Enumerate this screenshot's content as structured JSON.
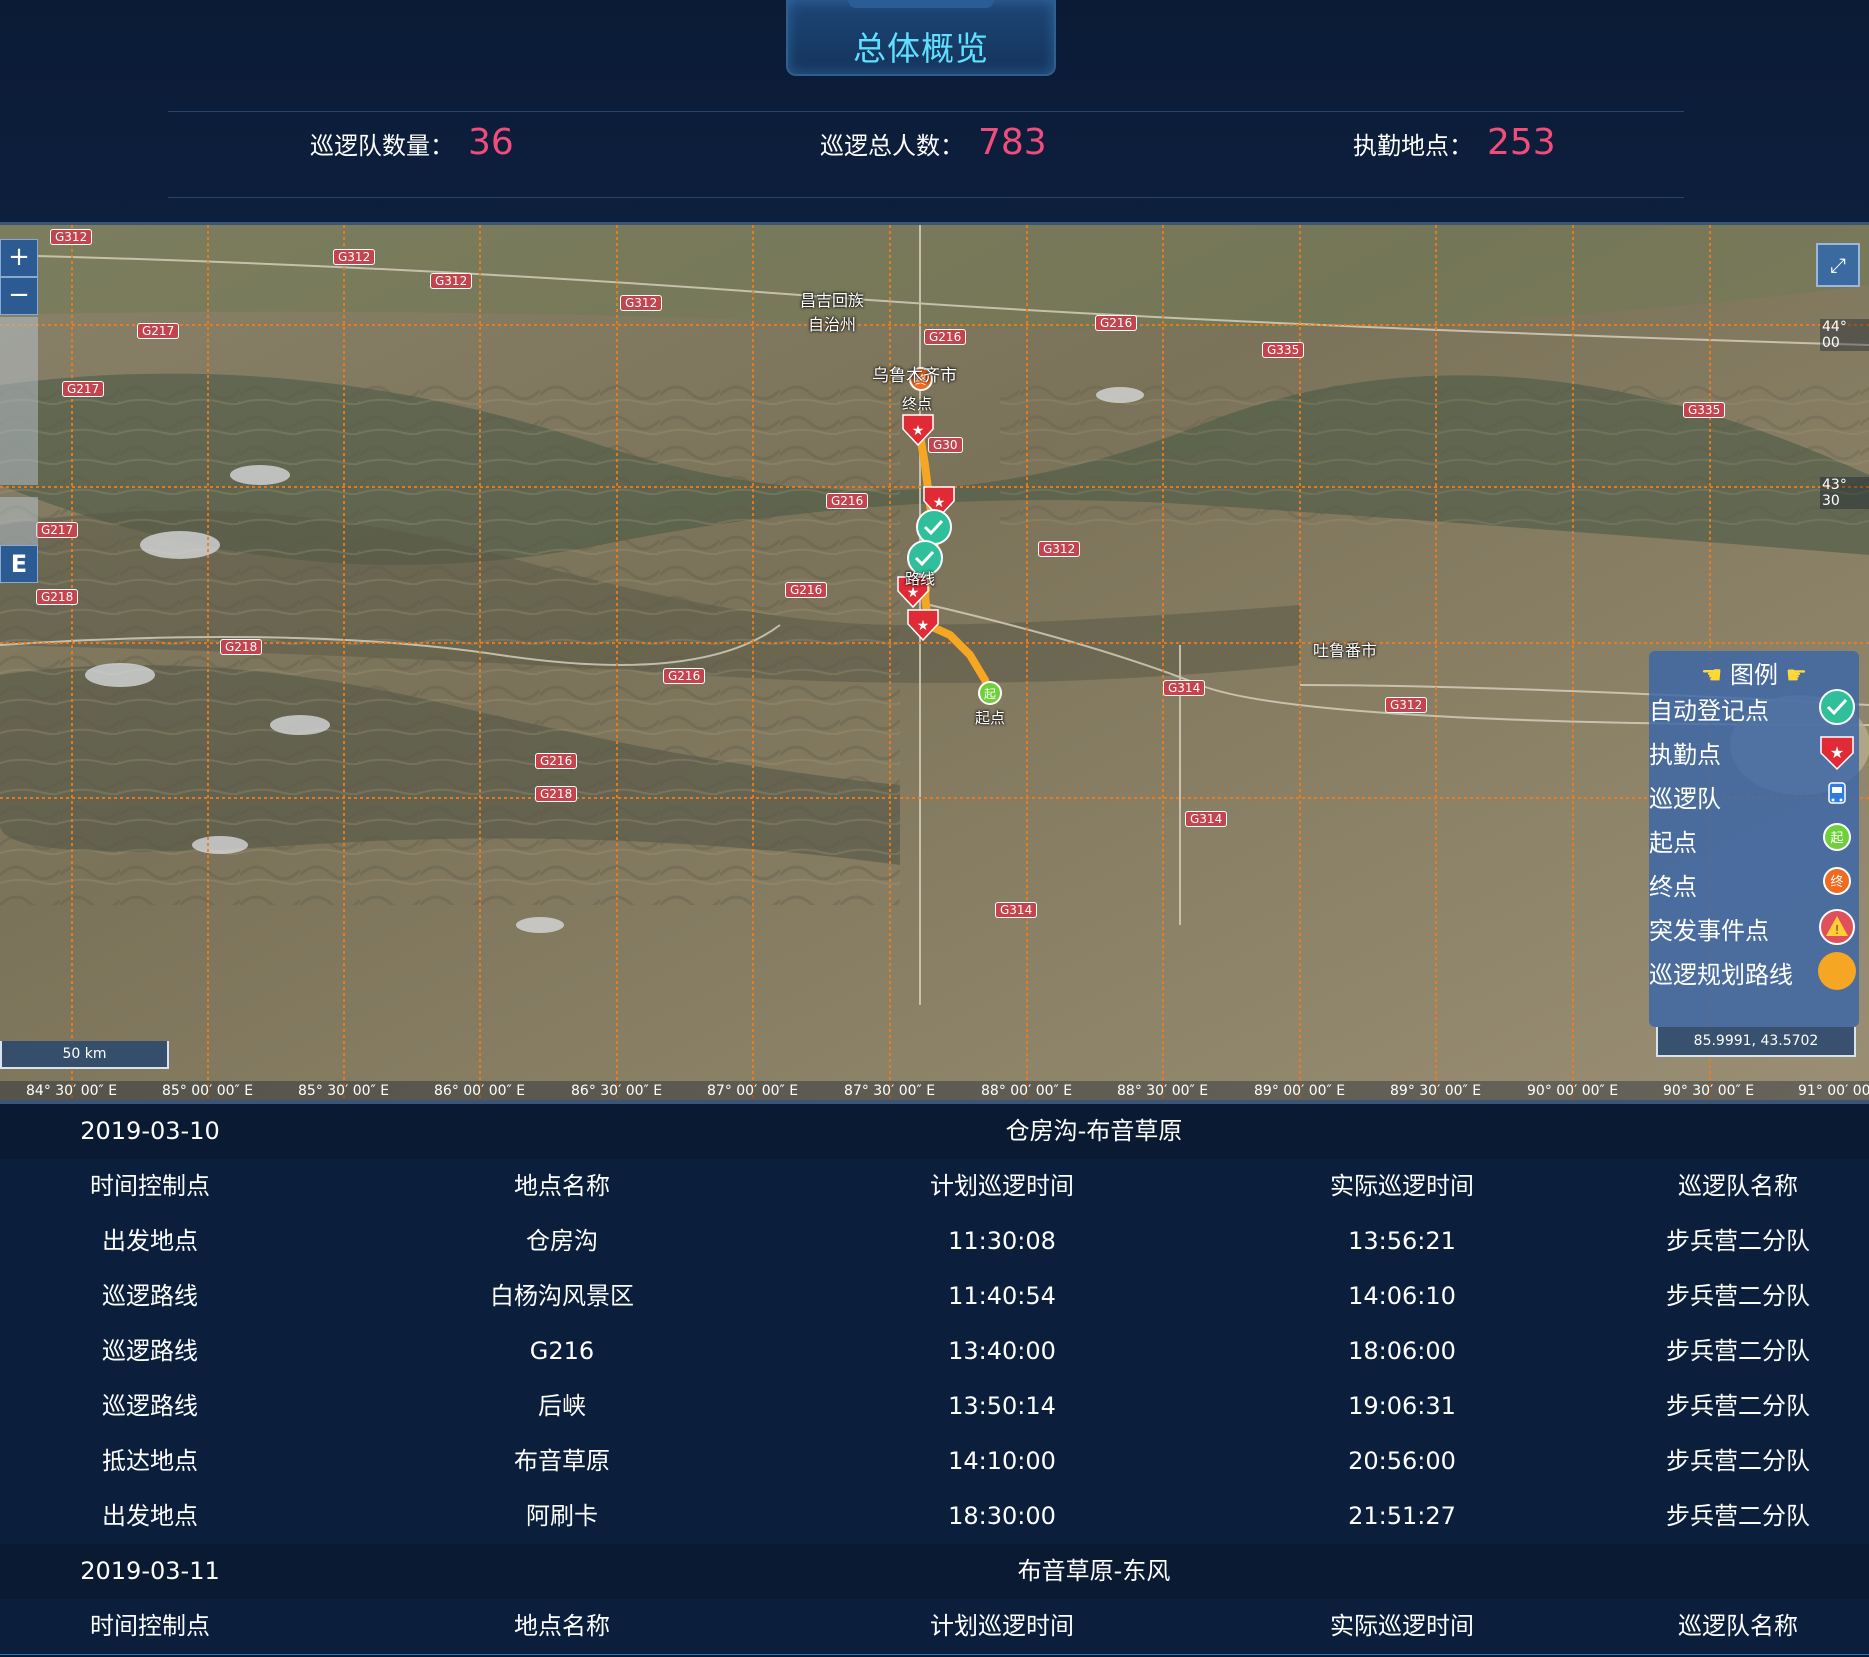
{
  "header": {
    "title": "总体概览"
  },
  "stats": [
    {
      "label": "巡逻队数量：",
      "value": "36"
    },
    {
      "label": "巡逻总人数：",
      "value": "783"
    },
    {
      "label": "执勤地点：",
      "value": "253"
    }
  ],
  "map": {
    "zoom_in": "+",
    "zoom_out": "−",
    "e_button": "E",
    "scale": "50 km",
    "coordinates": "85.9991, 43.5702",
    "longitude_labels": [
      "84° 30′ 00″ E",
      "85° 00′ 00″ E",
      "85° 30′ 00″ E",
      "86° 00′ 00″ E",
      "86° 30′ 00″ E",
      "87° 00′ 00″ E",
      "87° 30′ 00″ E",
      "88° 00′ 00″ E",
      "88° 30′ 00″ E",
      "89° 00′ 00″ E",
      "89° 30′ 00″ E",
      "90° 00′ 00″ E",
      "90° 30′ 00″ E",
      "91° 00′ 00″"
    ],
    "latitude_labels": [
      "44° 00",
      "43° 30"
    ],
    "places": {
      "changji": "昌吉回族\n自治州",
      "urumqi": "乌鲁木齐市",
      "turpan": "吐鲁番市",
      "end": "终点",
      "start": "起点",
      "route_text": "路线"
    },
    "roads": [
      "G312",
      "G312",
      "G312",
      "G312",
      "G217",
      "G217",
      "G217",
      "G218",
      "G218",
      "G218",
      "G216",
      "G216",
      "G216",
      "G216",
      "G216",
      "G312",
      "G314",
      "G314",
      "G314",
      "G312",
      "G335",
      "G335",
      "G30",
      "G216"
    ],
    "legend": {
      "title": "图例",
      "items": [
        "自动登记点",
        "执勤点",
        "巡逻队",
        "起点",
        "终点",
        "突发事件点",
        "巡逻规划路线"
      ]
    },
    "colors": {
      "route": "#f5a623",
      "duty_point": "#e02a36",
      "checkpoint": "#2fbf9b",
      "start": "#6fd13a",
      "end": "#f06a1f",
      "grid": "#f07d1a"
    }
  },
  "schedule": [
    {
      "date": "2019-03-10",
      "route": "仓房沟-布音草原",
      "headers": [
        "时间控制点",
        "地点名称",
        "计划巡逻时间",
        "实际巡逻时间",
        "巡逻队名称"
      ],
      "rows": [
        [
          "出发地点",
          "仓房沟",
          "11:30:08",
          "13:56:21",
          "步兵营二分队"
        ],
        [
          "巡逻路线",
          "白杨沟风景区",
          "11:40:54",
          "14:06:10",
          "步兵营二分队"
        ],
        [
          "巡逻路线",
          "G216",
          "13:40:00",
          "18:06:00",
          "步兵营二分队"
        ],
        [
          "巡逻路线",
          "后峡",
          "13:50:14",
          "19:06:31",
          "步兵营二分队"
        ],
        [
          "抵达地点",
          "布音草原",
          "14:10:00",
          "20:56:00",
          "步兵营二分队"
        ],
        [
          "出发地点",
          "阿刷卡",
          "18:30:00",
          "21:51:27",
          "步兵营二分队"
        ]
      ]
    },
    {
      "date": "2019-03-11",
      "route": "布音草原-东风",
      "headers": [
        "时间控制点",
        "地点名称",
        "计划巡逻时间",
        "实际巡逻时间",
        "巡逻队名称"
      ],
      "rows": []
    }
  ]
}
